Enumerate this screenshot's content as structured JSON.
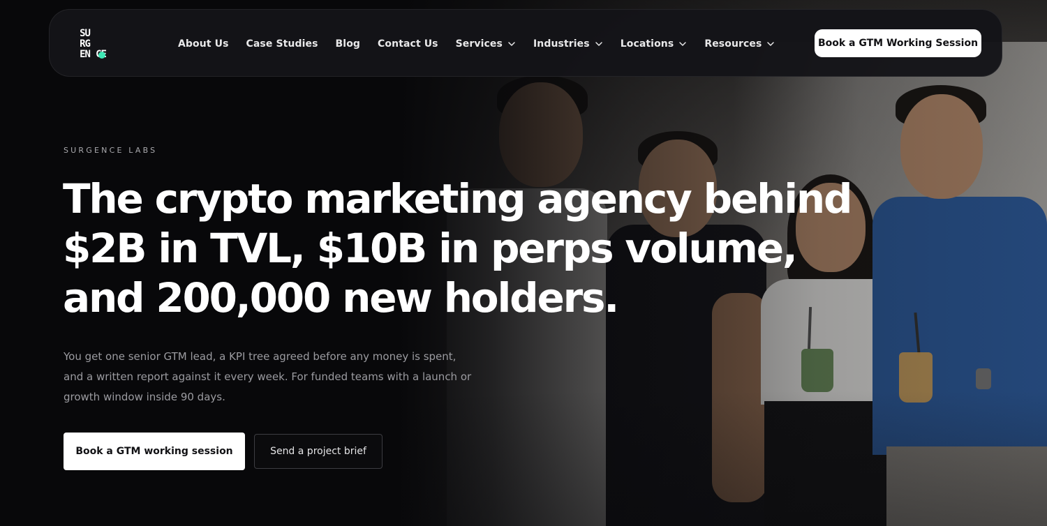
{
  "brand": {
    "logo_letters": [
      "SU",
      "RG",
      "EN",
      "CE",
      "",
      ""
    ],
    "accent_color": "#3ee8b5"
  },
  "nav": {
    "items": [
      {
        "label": "About Us",
        "has_dropdown": false
      },
      {
        "label": "Case Studies",
        "has_dropdown": false
      },
      {
        "label": "Blog",
        "has_dropdown": false
      },
      {
        "label": "Contact Us",
        "has_dropdown": false
      },
      {
        "label": "Services",
        "has_dropdown": true
      },
      {
        "label": "Industries",
        "has_dropdown": true
      },
      {
        "label": "Locations",
        "has_dropdown": true
      },
      {
        "label": "Resources",
        "has_dropdown": true
      }
    ],
    "cta_label": "Book a GTM Working Session",
    "chevron_icon": "chevron-down-icon"
  },
  "hero": {
    "eyebrow": "SURGENCE LABS",
    "headline_line1": "The crypto marketing agency behind",
    "headline_line2": "$2B in TVL, $10B in perps volume,",
    "headline_line3": "and 200,000 new holders.",
    "subtext": "You get one senior GTM lead, a KPI tree agreed before any money is spent, and a written report against it every week. For funded teams with a launch or growth window inside 90 days.",
    "primary_button": "Book a GTM working session",
    "secondary_button": "Send a project brief"
  },
  "colors": {
    "background": "#09090b",
    "navbar": "#141418",
    "text_primary": "#ffffff",
    "text_muted": "#9b9ba0"
  }
}
